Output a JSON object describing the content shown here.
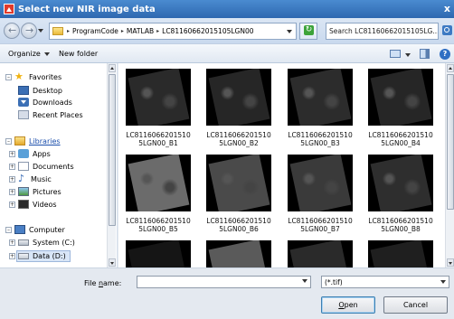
{
  "window": {
    "title": "Select new NIR image data",
    "close_glyph": "x"
  },
  "address": {
    "crumbs": [
      "ProgramCode",
      "MATLAB",
      "LC81160662015105LGN00"
    ],
    "search_placeholder": "Search LC81160662015105LG..."
  },
  "toolbar": {
    "organize_label": "Organize",
    "new_folder_label": "New folder"
  },
  "sidebar": {
    "favorites": {
      "label": "Favorites",
      "items": [
        "Desktop",
        "Downloads",
        "Recent Places"
      ]
    },
    "libraries": {
      "label": "Libraries",
      "items": [
        "Apps",
        "Documents",
        "Music",
        "Pictures",
        "Videos"
      ]
    },
    "computer": {
      "label": "Computer",
      "items": [
        "System (C:)",
        "Data (D:)"
      ]
    }
  },
  "files": [
    {
      "line1": "LC8116066201510",
      "line2": "5LGN00_B1",
      "tone": "#2a2a2a"
    },
    {
      "line1": "LC8116066201510",
      "line2": "5LGN00_B2",
      "tone": "#262626"
    },
    {
      "line1": "LC8116066201510",
      "line2": "5LGN00_B3",
      "tone": "#2c2c2c"
    },
    {
      "line1": "LC8116066201510",
      "line2": "5LGN00_B4",
      "tone": "#262626"
    },
    {
      "line1": "LC8116066201510",
      "line2": "5LGN00_B5",
      "tone": "#6b6b6b"
    },
    {
      "line1": "LC8116066201510",
      "line2": "5LGN00_B6",
      "tone": "#4a4a4a"
    },
    {
      "line1": "LC8116066201510",
      "line2": "5LGN00_B7",
      "tone": "#3a3a3a"
    },
    {
      "line1": "LC8116066201510",
      "line2": "5LGN00_B8",
      "tone": "#2e2e2e"
    }
  ],
  "footer": {
    "file_name_label_pre": "File ",
    "file_name_label_u": "n",
    "file_name_label_post": "ame:",
    "file_name_value": "",
    "file_type": "(*.tif)",
    "open_u": "O",
    "open_rest": "pen",
    "cancel_label": "Cancel"
  }
}
